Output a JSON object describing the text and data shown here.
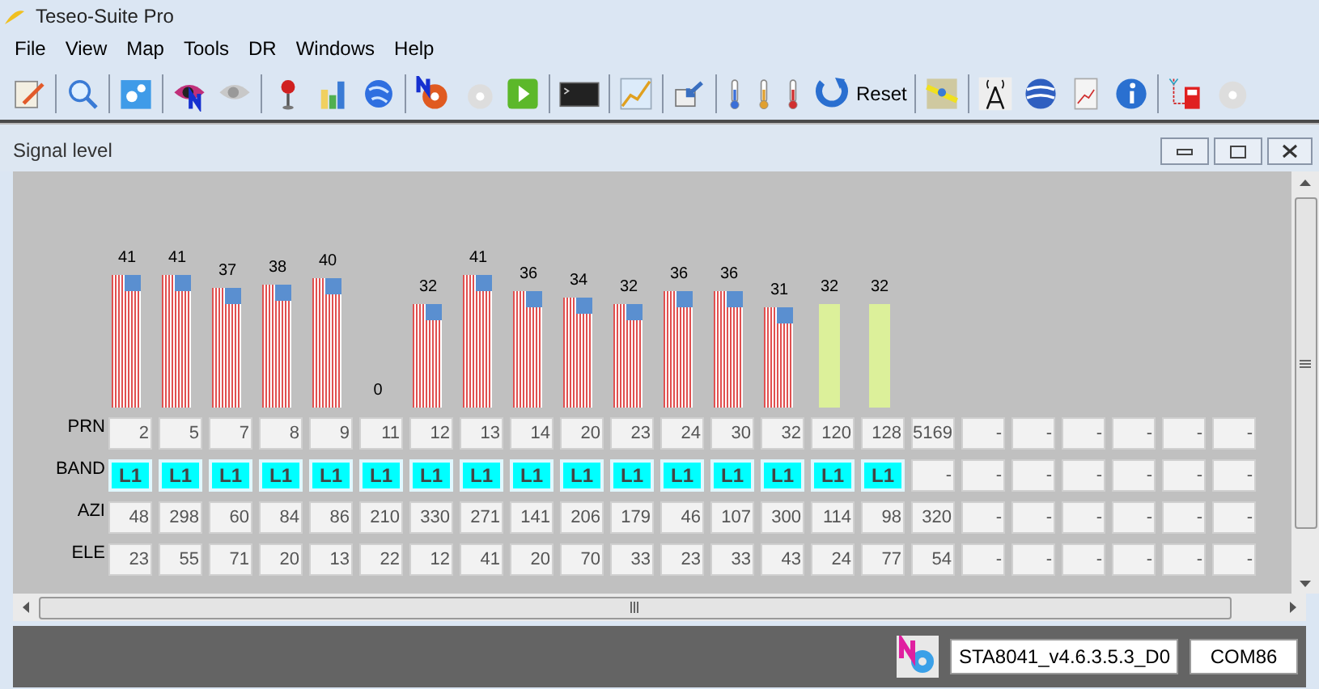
{
  "window": {
    "title": "Teseo-Suite Pro"
  },
  "menu": [
    "File",
    "View",
    "Map",
    "Tools",
    "DR",
    "Windows",
    "Help"
  ],
  "toolbar": {
    "reset_label": "Reset"
  },
  "panel": {
    "title": "Signal level"
  },
  "row_labels": [
    "PRN",
    "BAND",
    "AZI",
    "ELE"
  ],
  "satellites": [
    {
      "kind": "flag",
      "signal": "41",
      "prn": "2",
      "band": "L1",
      "tracked": true,
      "azi": "48",
      "ele": "23"
    },
    {
      "kind": "flag",
      "signal": "41",
      "prn": "5",
      "band": "L1",
      "tracked": true,
      "azi": "298",
      "ele": "55"
    },
    {
      "kind": "flag",
      "signal": "37",
      "prn": "7",
      "band": "L1",
      "tracked": true,
      "azi": "60",
      "ele": "71"
    },
    {
      "kind": "flag",
      "signal": "38",
      "prn": "8",
      "band": "L1",
      "tracked": true,
      "azi": "84",
      "ele": "20"
    },
    {
      "kind": "flag",
      "signal": "40",
      "prn": "9",
      "band": "L1",
      "tracked": true,
      "azi": "86",
      "ele": "13"
    },
    {
      "kind": "flag",
      "signal": "0",
      "prn": "11",
      "band": "L1",
      "tracked": true,
      "azi": "210",
      "ele": "22"
    },
    {
      "kind": "flag",
      "signal": "32",
      "prn": "12",
      "band": "L1",
      "tracked": true,
      "azi": "330",
      "ele": "12"
    },
    {
      "kind": "flag",
      "signal": "41",
      "prn": "13",
      "band": "L1",
      "tracked": true,
      "azi": "271",
      "ele": "41"
    },
    {
      "kind": "flag",
      "signal": "36",
      "prn": "14",
      "band": "L1",
      "tracked": true,
      "azi": "141",
      "ele": "20"
    },
    {
      "kind": "flag",
      "signal": "34",
      "prn": "20",
      "band": "L1",
      "tracked": true,
      "azi": "206",
      "ele": "70"
    },
    {
      "kind": "flag",
      "signal": "32",
      "prn": "23",
      "band": "L1",
      "tracked": true,
      "azi": "179",
      "ele": "33"
    },
    {
      "kind": "flag",
      "signal": "36",
      "prn": "24",
      "band": "L1",
      "tracked": true,
      "azi": "46",
      "ele": "23"
    },
    {
      "kind": "flag",
      "signal": "36",
      "prn": "30",
      "band": "L1",
      "tracked": true,
      "azi": "107",
      "ele": "33"
    },
    {
      "kind": "flag",
      "signal": "31",
      "prn": "32",
      "band": "L1",
      "tracked": true,
      "azi": "300",
      "ele": "43"
    },
    {
      "kind": "plain",
      "signal": "32",
      "prn": "120",
      "band": "L1",
      "tracked": true,
      "azi": "114",
      "ele": "24"
    },
    {
      "kind": "plain",
      "signal": "32",
      "prn": "128",
      "band": "L1",
      "tracked": true,
      "azi": "98",
      "ele": "77"
    },
    {
      "kind": "none",
      "prn": "5169",
      "band": "-",
      "tracked": false,
      "azi": "320",
      "ele": "54"
    },
    {
      "kind": "none",
      "prn": "-",
      "band": "-",
      "tracked": false,
      "azi": "-",
      "ele": "-"
    },
    {
      "kind": "none",
      "prn": "-",
      "band": "-",
      "tracked": false,
      "azi": "-",
      "ele": "-"
    },
    {
      "kind": "none",
      "prn": "-",
      "band": "-",
      "tracked": false,
      "azi": "-",
      "ele": "-"
    },
    {
      "kind": "none",
      "prn": "-",
      "band": "-",
      "tracked": false,
      "azi": "-",
      "ele": "-"
    },
    {
      "kind": "none",
      "prn": "-",
      "band": "-",
      "tracked": false,
      "azi": "-",
      "ele": "-"
    },
    {
      "kind": "none",
      "prn": "-",
      "band": "-",
      "tracked": false,
      "azi": "-",
      "ele": "-"
    }
  ],
  "status_bar": {
    "firmware": "STA8041_v4.6.3.5.3_D0",
    "port": "COM86"
  }
}
